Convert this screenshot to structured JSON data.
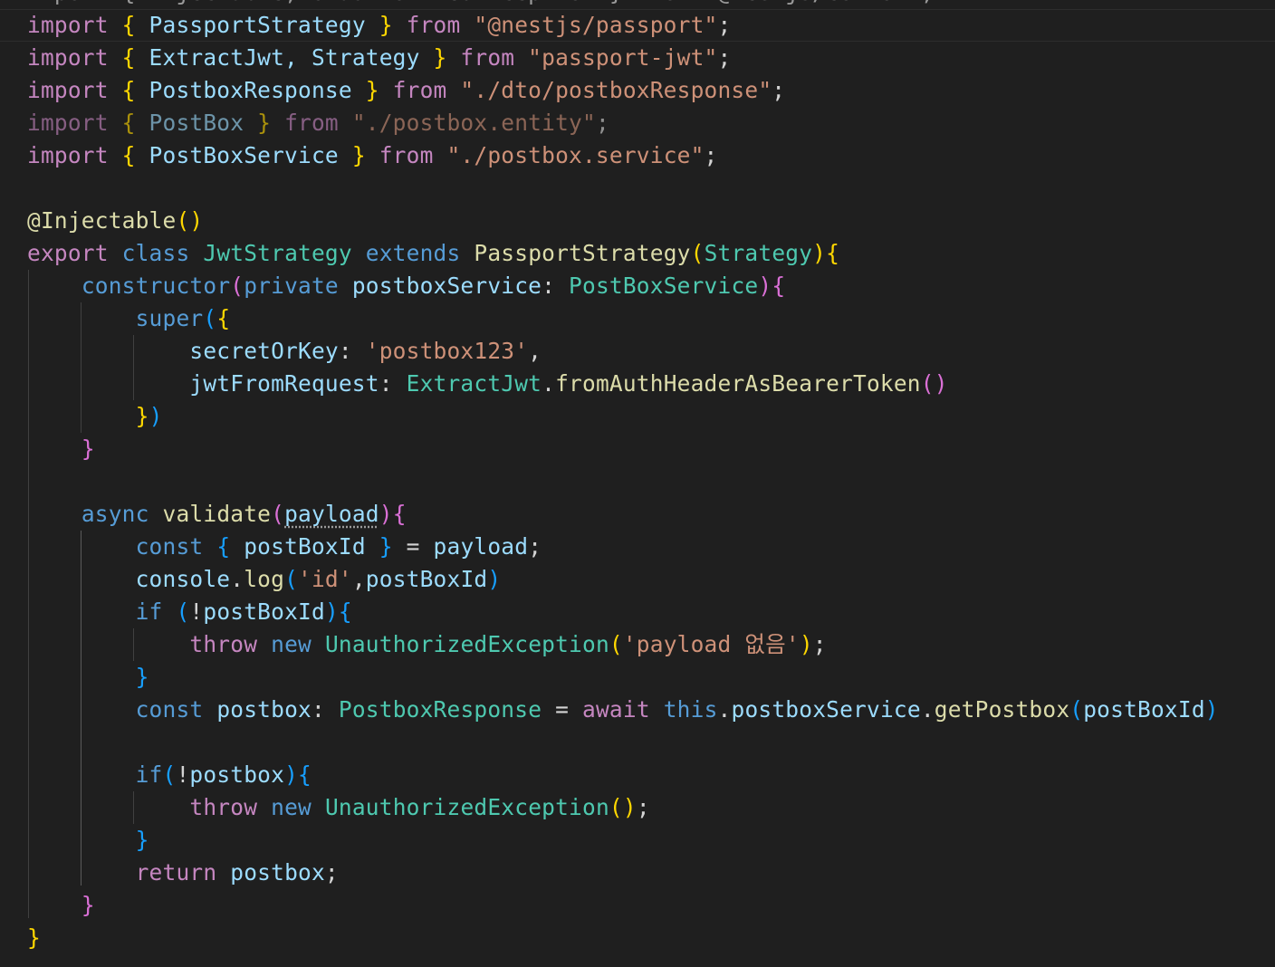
{
  "editor": {
    "top_partial": "import { Injectable, UnauthorizedException } from \"@nestjs/common\";",
    "lines": [
      [
        {
          "t": "import",
          "c": "kw-import"
        },
        {
          "t": " ",
          "c": "plain"
        },
        {
          "t": "{",
          "c": "br1"
        },
        {
          "t": " PassportStrategy ",
          "c": "var"
        },
        {
          "t": "}",
          "c": "br1"
        },
        {
          "t": " from ",
          "c": "kw-import"
        },
        {
          "t": "\"@nestjs/passport\"",
          "c": "str"
        },
        {
          "t": ";",
          "c": "plain"
        }
      ],
      [
        {
          "t": "import",
          "c": "kw-import"
        },
        {
          "t": " ",
          "c": "plain"
        },
        {
          "t": "{",
          "c": "br1"
        },
        {
          "t": " ExtractJwt, Strategy ",
          "c": "var"
        },
        {
          "t": "}",
          "c": "br1"
        },
        {
          "t": " from ",
          "c": "kw-import"
        },
        {
          "t": "\"passport-jwt\"",
          "c": "str"
        },
        {
          "t": ";",
          "c": "plain"
        }
      ],
      [
        {
          "t": "import",
          "c": "kw-import"
        },
        {
          "t": " ",
          "c": "plain"
        },
        {
          "t": "{",
          "c": "br1"
        },
        {
          "t": " PostboxResponse ",
          "c": "var"
        },
        {
          "t": "}",
          "c": "br1"
        },
        {
          "t": " from ",
          "c": "kw-import"
        },
        {
          "t": "\"./dto/postboxResponse\"",
          "c": "str"
        },
        {
          "t": ";",
          "c": "plain"
        }
      ],
      [
        {
          "t": "import",
          "c": "kw-import faded"
        },
        {
          "t": " ",
          "c": "plain"
        },
        {
          "t": "{",
          "c": "br1 faded"
        },
        {
          "t": " PostBox ",
          "c": "var faded"
        },
        {
          "t": "}",
          "c": "br1 faded"
        },
        {
          "t": " from ",
          "c": "kw-import faded"
        },
        {
          "t": "\"./postbox.entity\"",
          "c": "str faded"
        },
        {
          "t": ";",
          "c": "plain faded"
        }
      ],
      [
        {
          "t": "import",
          "c": "kw-import"
        },
        {
          "t": " ",
          "c": "plain"
        },
        {
          "t": "{",
          "c": "br1"
        },
        {
          "t": " PostBoxService ",
          "c": "var"
        },
        {
          "t": "}",
          "c": "br1"
        },
        {
          "t": " from ",
          "c": "kw-import"
        },
        {
          "t": "\"./postbox.service\"",
          "c": "str"
        },
        {
          "t": ";",
          "c": "plain"
        }
      ],
      [],
      [
        {
          "t": "@Injectable",
          "c": "fn"
        },
        {
          "t": "()",
          "c": "br1"
        }
      ],
      [
        {
          "t": "export",
          "c": "kw-import"
        },
        {
          "t": " ",
          "c": "plain"
        },
        {
          "t": "class",
          "c": "kw-blue"
        },
        {
          "t": " ",
          "c": "plain"
        },
        {
          "t": "JwtStrategy",
          "c": "type"
        },
        {
          "t": " ",
          "c": "plain"
        },
        {
          "t": "extends",
          "c": "kw-blue"
        },
        {
          "t": " ",
          "c": "plain"
        },
        {
          "t": "PassportStrategy",
          "c": "fn"
        },
        {
          "t": "(",
          "c": "br1"
        },
        {
          "t": "Strategy",
          "c": "type"
        },
        {
          "t": ")",
          "c": "br1"
        },
        {
          "t": "{",
          "c": "br1"
        }
      ],
      [
        {
          "t": "    ",
          "c": "plain"
        },
        {
          "t": "constructor",
          "c": "kw-blue"
        },
        {
          "t": "(",
          "c": "br2"
        },
        {
          "t": "private",
          "c": "kw-blue"
        },
        {
          "t": " ",
          "c": "plain"
        },
        {
          "t": "postboxService",
          "c": "var"
        },
        {
          "t": ": ",
          "c": "plain"
        },
        {
          "t": "PostBoxService",
          "c": "type"
        },
        {
          "t": ")",
          "c": "br2"
        },
        {
          "t": "{",
          "c": "br2"
        }
      ],
      [
        {
          "t": "        ",
          "c": "plain"
        },
        {
          "t": "super",
          "c": "kw-blue"
        },
        {
          "t": "(",
          "c": "br3"
        },
        {
          "t": "{",
          "c": "br1"
        }
      ],
      [
        {
          "t": "            ",
          "c": "plain"
        },
        {
          "t": "secretOrKey",
          "c": "var"
        },
        {
          "t": ": ",
          "c": "plain"
        },
        {
          "t": "'postbox123'",
          "c": "str"
        },
        {
          "t": ",",
          "c": "plain"
        }
      ],
      [
        {
          "t": "            ",
          "c": "plain"
        },
        {
          "t": "jwtFromRequest",
          "c": "var"
        },
        {
          "t": ": ",
          "c": "plain"
        },
        {
          "t": "ExtractJwt",
          "c": "type"
        },
        {
          "t": ".",
          "c": "plain"
        },
        {
          "t": "fromAuthHeaderAsBearerToken",
          "c": "fn"
        },
        {
          "t": "()",
          "c": "br2"
        }
      ],
      [
        {
          "t": "        ",
          "c": "plain"
        },
        {
          "t": "}",
          "c": "br1"
        },
        {
          "t": ")",
          "c": "br3"
        }
      ],
      [
        {
          "t": "    ",
          "c": "plain"
        },
        {
          "t": "}",
          "c": "br2"
        }
      ],
      [],
      [
        {
          "t": "    ",
          "c": "plain"
        },
        {
          "t": "async",
          "c": "kw-blue"
        },
        {
          "t": " ",
          "c": "plain"
        },
        {
          "t": "validate",
          "c": "fn"
        },
        {
          "t": "(",
          "c": "br2"
        },
        {
          "t": "payload",
          "c": "var squiggle"
        },
        {
          "t": ")",
          "c": "br2"
        },
        {
          "t": "{",
          "c": "br2"
        }
      ],
      [
        {
          "t": "        ",
          "c": "plain"
        },
        {
          "t": "const",
          "c": "kw-blue"
        },
        {
          "t": " ",
          "c": "plain"
        },
        {
          "t": "{",
          "c": "br3"
        },
        {
          "t": " postBoxId ",
          "c": "var"
        },
        {
          "t": "}",
          "c": "br3"
        },
        {
          "t": " = ",
          "c": "plain"
        },
        {
          "t": "payload",
          "c": "var"
        },
        {
          "t": ";",
          "c": "plain"
        }
      ],
      [
        {
          "t": "        ",
          "c": "plain"
        },
        {
          "t": "console",
          "c": "var"
        },
        {
          "t": ".",
          "c": "plain"
        },
        {
          "t": "log",
          "c": "fn"
        },
        {
          "t": "(",
          "c": "br3"
        },
        {
          "t": "'id'",
          "c": "str"
        },
        {
          "t": ",",
          "c": "plain"
        },
        {
          "t": "postBoxId",
          "c": "var"
        },
        {
          "t": ")",
          "c": "br3"
        }
      ],
      [
        {
          "t": "        ",
          "c": "plain"
        },
        {
          "t": "if",
          "c": "kw-blue"
        },
        {
          "t": " ",
          "c": "plain"
        },
        {
          "t": "(",
          "c": "br3"
        },
        {
          "t": "!",
          "c": "plain"
        },
        {
          "t": "postBoxId",
          "c": "var"
        },
        {
          "t": ")",
          "c": "br3"
        },
        {
          "t": "{",
          "c": "br3"
        }
      ],
      [
        {
          "t": "            ",
          "c": "plain"
        },
        {
          "t": "throw",
          "c": "kw-ctrl"
        },
        {
          "t": " ",
          "c": "plain"
        },
        {
          "t": "new",
          "c": "kw-blue"
        },
        {
          "t": " ",
          "c": "plain"
        },
        {
          "t": "UnauthorizedException",
          "c": "type"
        },
        {
          "t": "(",
          "c": "br1"
        },
        {
          "t": "'payload 없음'",
          "c": "str"
        },
        {
          "t": ")",
          "c": "br1"
        },
        {
          "t": ";",
          "c": "plain"
        }
      ],
      [
        {
          "t": "        ",
          "c": "plain"
        },
        {
          "t": "}",
          "c": "br3"
        }
      ],
      [
        {
          "t": "        ",
          "c": "plain"
        },
        {
          "t": "const",
          "c": "kw-blue"
        },
        {
          "t": " ",
          "c": "plain"
        },
        {
          "t": "postbox",
          "c": "var"
        },
        {
          "t": ": ",
          "c": "plain"
        },
        {
          "t": "PostboxResponse",
          "c": "type"
        },
        {
          "t": " = ",
          "c": "plain"
        },
        {
          "t": "await",
          "c": "kw-ctrl"
        },
        {
          "t": " ",
          "c": "plain"
        },
        {
          "t": "this",
          "c": "kw-blue"
        },
        {
          "t": ".",
          "c": "plain"
        },
        {
          "t": "postboxService",
          "c": "var"
        },
        {
          "t": ".",
          "c": "plain"
        },
        {
          "t": "getPostbox",
          "c": "fn"
        },
        {
          "t": "(",
          "c": "br3"
        },
        {
          "t": "postBoxId",
          "c": "var"
        },
        {
          "t": ")",
          "c": "br3"
        }
      ],
      [],
      [
        {
          "t": "        ",
          "c": "plain"
        },
        {
          "t": "if",
          "c": "kw-blue"
        },
        {
          "t": "(",
          "c": "br3"
        },
        {
          "t": "!",
          "c": "plain"
        },
        {
          "t": "postbox",
          "c": "var"
        },
        {
          "t": ")",
          "c": "br3"
        },
        {
          "t": "{",
          "c": "br3"
        }
      ],
      [
        {
          "t": "            ",
          "c": "plain"
        },
        {
          "t": "throw",
          "c": "kw-ctrl"
        },
        {
          "t": " ",
          "c": "plain"
        },
        {
          "t": "new",
          "c": "kw-blue"
        },
        {
          "t": " ",
          "c": "plain"
        },
        {
          "t": "UnauthorizedException",
          "c": "type"
        },
        {
          "t": "()",
          "c": "br1"
        },
        {
          "t": ";",
          "c": "plain"
        }
      ],
      [
        {
          "t": "        ",
          "c": "plain"
        },
        {
          "t": "}",
          "c": "br3"
        }
      ],
      [
        {
          "t": "        ",
          "c": "plain"
        },
        {
          "t": "return",
          "c": "kw-ctrl"
        },
        {
          "t": " ",
          "c": "plain"
        },
        {
          "t": "postbox",
          "c": "var"
        },
        {
          "t": ";",
          "c": "plain"
        }
      ],
      [
        {
          "t": "    ",
          "c": "plain"
        },
        {
          "t": "}",
          "c": "br2"
        }
      ],
      [
        {
          "t": "}",
          "c": "br1"
        }
      ]
    ]
  }
}
